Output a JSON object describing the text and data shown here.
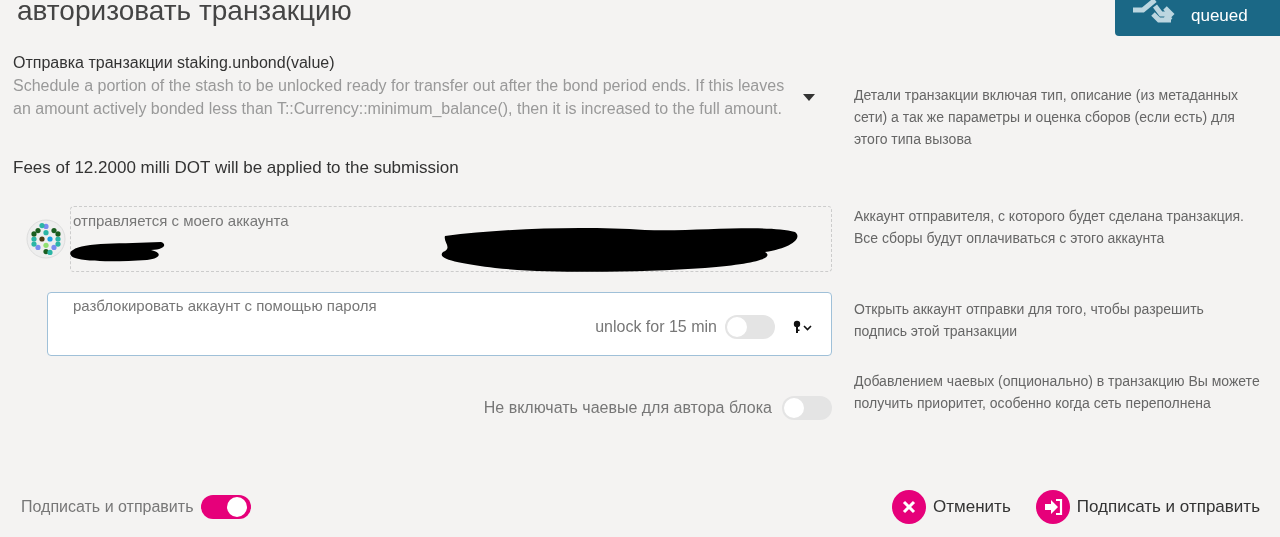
{
  "title": "авторизовать транзакцию",
  "queue_button": {
    "label": "queued"
  },
  "transaction": {
    "heading": "Отправка транзакции staking.unbond(value)",
    "description": "Schedule a portion of the stash to be unlocked ready for transfer out after the bond period ends. If this leaves an amount actively bonded less than T::Currency::minimum_balance(), then it is increased to the full amount.",
    "expanded": false,
    "help": "Детали транзакции включая тип, описание (из метаданных сети) а так же параметры и оценка сборов (если есть) для этого типа вызова"
  },
  "fees": "Fees of 12.2000 milli DOT will be applied to the submission",
  "account": {
    "label": "отправляется с моего аккаунта",
    "help": "Аккаунт отправителя, с которого будет сделана транзакция. Все сборы будут оплачиваться с этого аккаунта"
  },
  "password": {
    "label": "разблокировать аккаунт с помощью пароля",
    "unlock_label": "unlock for 15 min",
    "unlock_on": false,
    "help": "Открыть аккаунт отправки для того, чтобы разрешить подпись этой транзакции"
  },
  "tip": {
    "label": "Не включать чаевые для автора блока",
    "on": false,
    "help": "Добавлением чаевых (опционально) в транзакцию Вы можете получить приоритет, особенно когда сеть переполнена"
  },
  "footer": {
    "sign_toggle": {
      "label": "Подписать и отправить",
      "on": true
    },
    "buttons": [
      {
        "kind": "cancel",
        "label": "Отменить"
      },
      {
        "kind": "sign",
        "label": "Подписать и отправить"
      }
    ]
  }
}
